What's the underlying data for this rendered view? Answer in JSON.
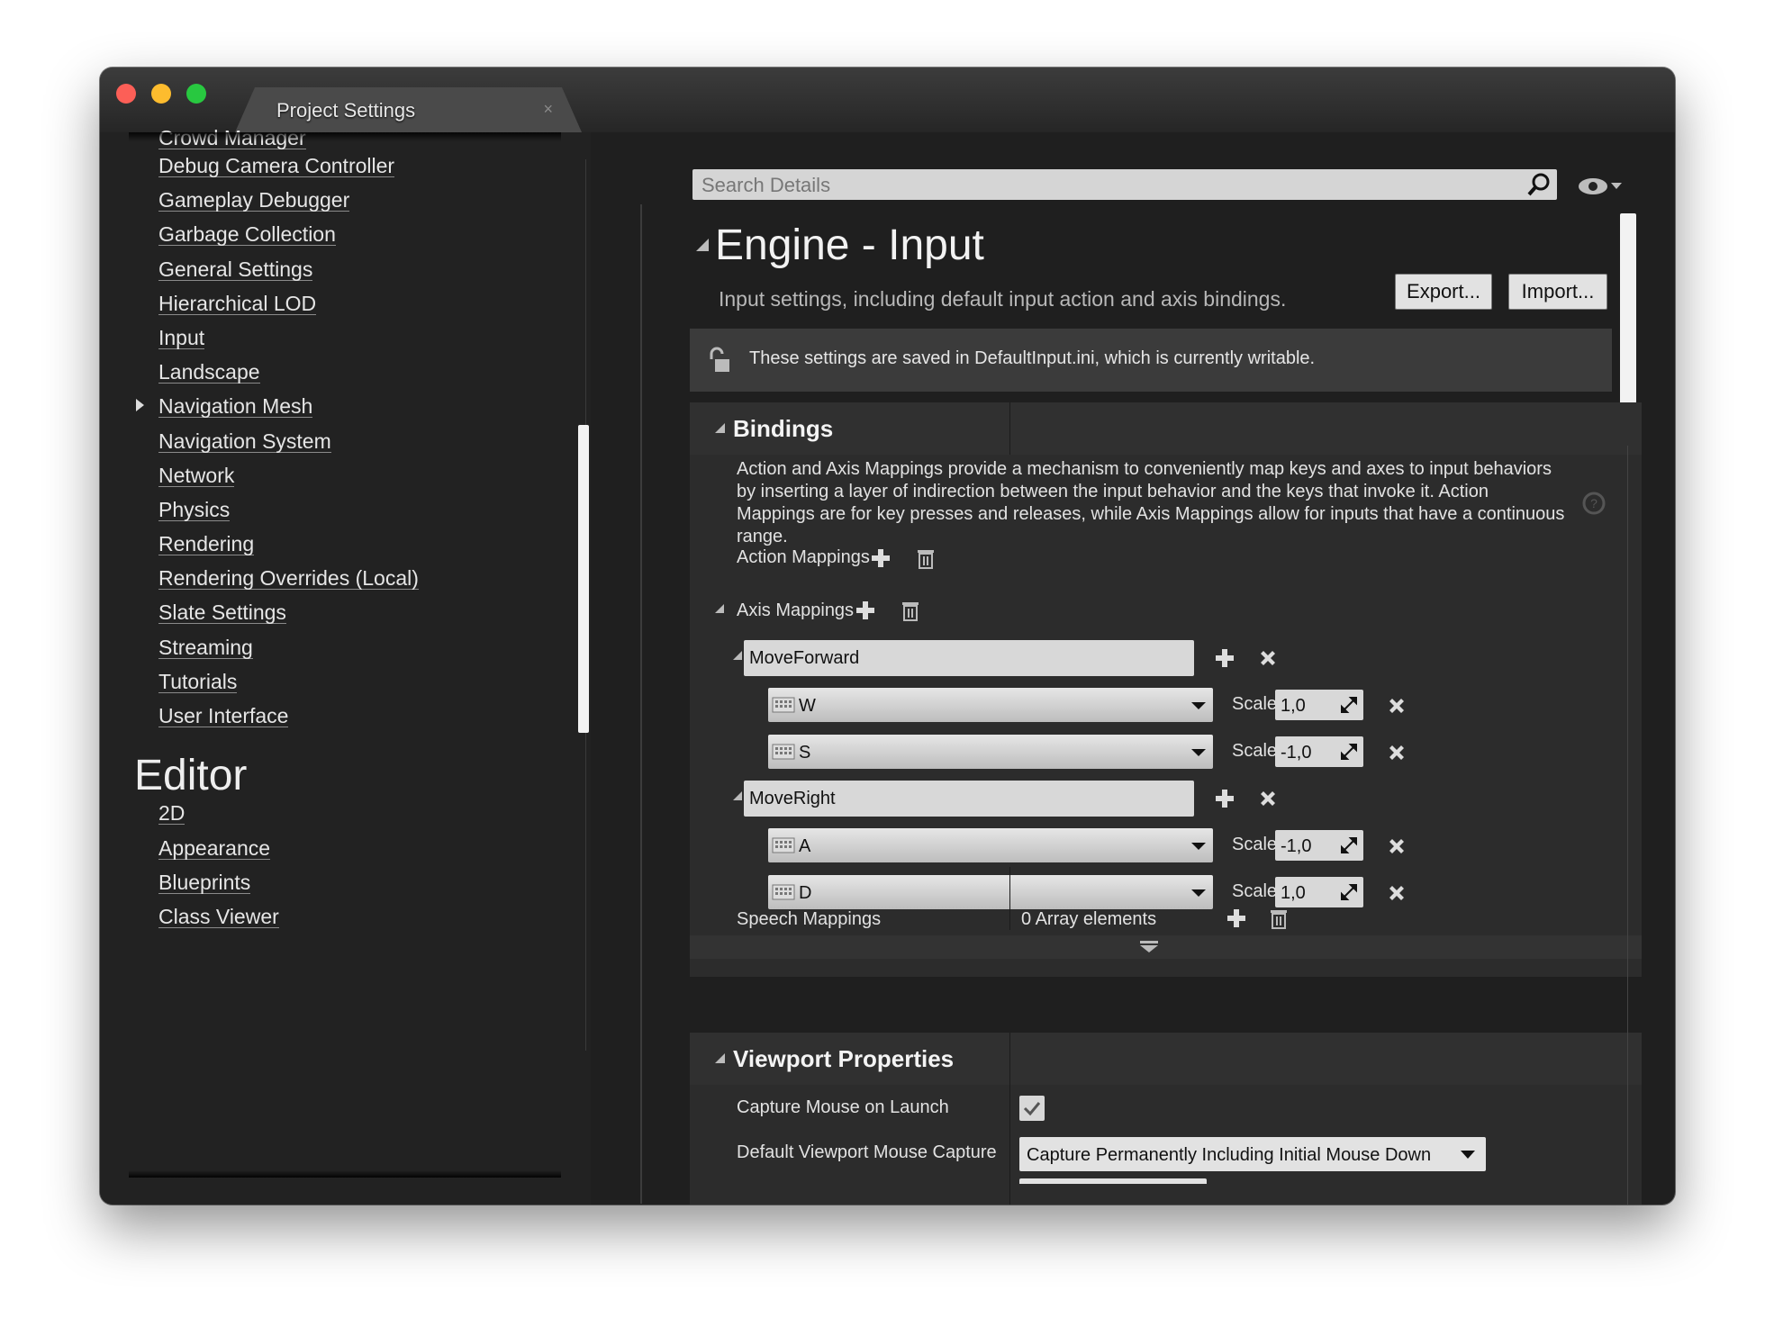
{
  "window": {
    "tab_title": "Project Settings",
    "tab_close": "×"
  },
  "sidebar": {
    "items": [
      {
        "label": "Crowd Manager"
      },
      {
        "label": "Debug Camera Controller"
      },
      {
        "label": "Gameplay Debugger"
      },
      {
        "label": "Garbage Collection"
      },
      {
        "label": "General Settings"
      },
      {
        "label": "Hierarchical LOD"
      },
      {
        "label": "Input",
        "selected": true
      },
      {
        "label": "Landscape"
      },
      {
        "label": "Navigation Mesh"
      },
      {
        "label": "Navigation System"
      },
      {
        "label": "Network"
      },
      {
        "label": "Physics"
      },
      {
        "label": "Rendering"
      },
      {
        "label": "Rendering Overrides (Local)"
      },
      {
        "label": "Slate Settings"
      },
      {
        "label": "Streaming"
      },
      {
        "label": "Tutorials"
      },
      {
        "label": "User Interface"
      }
    ],
    "editor_heading": "Editor",
    "editor_items": [
      {
        "label": "2D"
      },
      {
        "label": "Appearance"
      },
      {
        "label": "Blueprints"
      },
      {
        "label": "Class Viewer"
      }
    ]
  },
  "search": {
    "placeholder": "Search Details",
    "icon": "search-icon",
    "view_options_icon": "eye-icon"
  },
  "page": {
    "title": "Engine - Input",
    "description": "Input settings, including default input action and axis bindings.",
    "export_label": "Export...",
    "import_label": "Import...",
    "info_icon": "unlock-icon",
    "info_text": "These settings are saved in DefaultInput.ini, which is currently writable."
  },
  "bindings": {
    "title": "Bindings",
    "description": "Action and Axis Mappings provide a mechanism to conveniently map keys and axes to input behaviors by inserting a layer of indirection between the input behavior and the keys that invoke it. Action Mappings are for key presses and releases, while Axis Mappings allow for inputs that have a continuous range.",
    "action_mappings_label": "Action Mappings",
    "axis_mappings_label": "Axis Mappings",
    "scale_label": "Scale",
    "axis_mappings": [
      {
        "name": "MoveForward",
        "keys": [
          {
            "key": "W",
            "scale": "1,0"
          },
          {
            "key": "S",
            "scale": "-1,0"
          }
        ]
      },
      {
        "name": "MoveRight",
        "keys": [
          {
            "key": "A",
            "scale": "-1,0"
          },
          {
            "key": "D",
            "scale": "1,0"
          }
        ]
      }
    ],
    "speech_mappings_label": "Speech Mappings",
    "speech_mappings_value": "0 Array elements"
  },
  "viewport": {
    "title": "Viewport Properties",
    "capture_mouse_label": "Capture Mouse on Launch",
    "capture_mouse_checked": true,
    "mouse_capture_label": "Default Viewport Mouse Capture",
    "mouse_capture_value": "Capture Permanently Including Initial Mouse Down"
  },
  "colors": {
    "window_bg": "#1f1f1f",
    "panel_bg": "#2c2c2c",
    "text": "#e6e6e6",
    "close_red": "#fc5f57",
    "minimize_yellow": "#fdbc2e",
    "zoom_green": "#28c840"
  }
}
